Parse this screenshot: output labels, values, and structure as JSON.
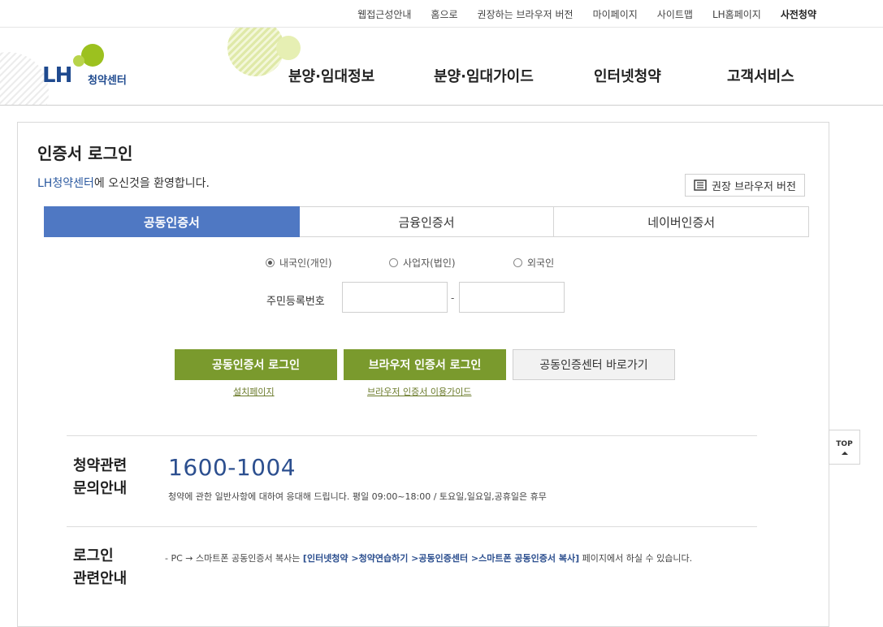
{
  "util_nav": [
    "웹접근성안내",
    "홈으로",
    "권장하는 브라우저 버전",
    "마이페이지",
    "사이트맵",
    "LH홈페이지",
    "사전청약"
  ],
  "logo": {
    "brand": "LH",
    "sub": "청약센터"
  },
  "gnb": [
    "분양·임대정보",
    "분양·임대가이드",
    "인터넷청약",
    "고객서비스"
  ],
  "login": {
    "title": "인증서 로그인",
    "welcome_link": "LH청약센터",
    "welcome_rest": "에 오신것을 환영합니다.",
    "browser_btn": "권장 브라우저 버전",
    "tabs": [
      "공동인증서",
      "금융인증서",
      "네이버인증서"
    ],
    "radios": [
      "내국인(개인)",
      "사업자(법인)",
      "외국인"
    ],
    "id_label": "주민등록번호",
    "id_dash": "-",
    "buttons": [
      "공동인증서 로그인",
      "브라우저 인증서 로그인",
      "공동인증센터 바로가기"
    ],
    "sublinks": [
      "설치페이지",
      "브라우저 인증서 이용가이드"
    ]
  },
  "inquiry": {
    "title_line1": "청약관련",
    "title_line2": "문의안내",
    "phone": "1600-1004",
    "desc": "청약에 관한 일반사항에 대하여 응대해 드립니다. 평일 09:00~18:00  /  토요일,일요일,공휴일은 휴무"
  },
  "login_info": {
    "title_line1": "로그인",
    "title_line2": "관련안내",
    "desc_prefix": "- PC → 스마트폰 공동인증서 복사는 ",
    "desc_path": "[인터넷청약 >청약연습하기 >공동인증센터 >스마트폰 공동인증서 복사]",
    "desc_suffix": " 페이지에서 하실 수 있습니다."
  },
  "top_btn": "TOP"
}
